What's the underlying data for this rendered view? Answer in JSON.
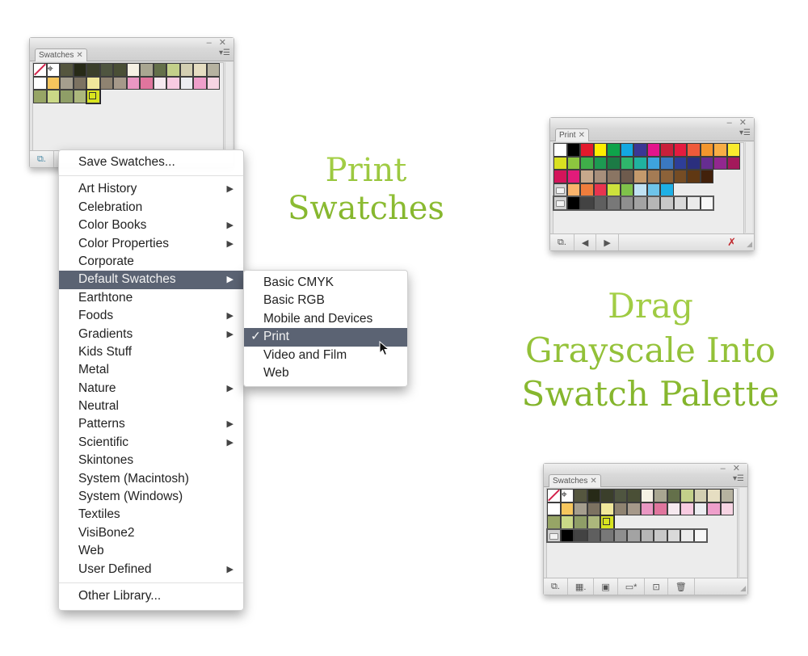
{
  "colors": {
    "menu_highlight": "#5b6373",
    "caption_green": "#8cbf2f"
  },
  "panel_swatches_top": {
    "tab_label": "Swatches",
    "tab_close": "✕",
    "win_controls": "– ✕",
    "panel_menu_icon": "panel-menu-icon",
    "footer_icon": "swatch-libraries-menu-icon",
    "rows": [
      [
        "none",
        "reg",
        "#55563f",
        "#272a17",
        "#3b3f2b",
        "#4f5540",
        "#4a4f36",
        "#f6f1e4",
        "#a9a691",
        "#64704a",
        "#c3d08a",
        "#d3cfb2",
        "#e6dec2",
        "#b6b2a0"
      ],
      [
        "#ffffff",
        "#f6c65d",
        "#a59e8e",
        "#7c7261",
        "#f0e79b",
        "#8f8371",
        "#a6998a",
        "#ea97c3",
        "#e0759d",
        "#f6e9ef",
        "#f8cbe1",
        "#ecedf1",
        "#ef9fcb",
        "#f7d4e3"
      ],
      [
        "#97a566",
        "#cad887",
        "#8f9e67",
        "#acb77c",
        "sel:#d8e41f"
      ]
    ]
  },
  "library_menu": {
    "items": [
      {
        "label": "Save Swatches...",
        "submenu": false
      },
      {
        "separator": true
      },
      {
        "label": "Art History",
        "submenu": true
      },
      {
        "label": "Celebration",
        "submenu": false
      },
      {
        "label": "Color Books",
        "submenu": true
      },
      {
        "label": "Color Properties",
        "submenu": true
      },
      {
        "label": "Corporate",
        "submenu": false
      },
      {
        "label": "Default Swatches",
        "submenu": true,
        "highlighted": true
      },
      {
        "label": "Earthtone",
        "submenu": false
      },
      {
        "label": "Foods",
        "submenu": true
      },
      {
        "label": "Gradients",
        "submenu": true
      },
      {
        "label": "Kids Stuff",
        "submenu": false
      },
      {
        "label": "Metal",
        "submenu": false
      },
      {
        "label": "Nature",
        "submenu": true
      },
      {
        "label": "Neutral",
        "submenu": false
      },
      {
        "label": "Patterns",
        "submenu": true
      },
      {
        "label": "Scientific",
        "submenu": true
      },
      {
        "label": "Skintones",
        "submenu": false
      },
      {
        "label": "System (Macintosh)",
        "submenu": false
      },
      {
        "label": "System (Windows)",
        "submenu": false
      },
      {
        "label": "Textiles",
        "submenu": false
      },
      {
        "label": "VisiBone2",
        "submenu": false
      },
      {
        "label": "Web",
        "submenu": false
      },
      {
        "label": "User Defined",
        "submenu": true
      },
      {
        "separator": true
      },
      {
        "label": "Other Library...",
        "submenu": false
      }
    ],
    "arrow_glyph": "▶"
  },
  "default_swatches_submenu": {
    "items": [
      {
        "label": "Basic CMYK"
      },
      {
        "label": "Basic RGB"
      },
      {
        "label": "Mobile and Devices"
      },
      {
        "label": "Print",
        "checked": true,
        "highlighted": true
      },
      {
        "label": "Video and Film"
      },
      {
        "label": "Web"
      }
    ],
    "check_glyph": "✓"
  },
  "captions": {
    "print_swatches": [
      "Print",
      "Swatches"
    ],
    "drag_grayscale": [
      "Drag",
      "Grayscale Into",
      "Swatch Palette"
    ]
  },
  "panel_print": {
    "tab_label": "Print",
    "tab_close": "✕",
    "win_controls": "– ✕",
    "footer_buttons": [
      {
        "name": "swatch-libraries-menu-icon",
        "glyph": "⧉."
      },
      {
        "name": "previous-library-icon",
        "glyph": "◀"
      },
      {
        "name": "next-library-icon",
        "glyph": "▶"
      }
    ],
    "footer_right_icon": "no-edit-icon",
    "rows": [
      [
        "#ffffff",
        "#000000",
        "#e3192c",
        "#fdee00",
        "#0ea34a",
        "#13a8e1",
        "#3a3795",
        "#e3148c",
        "#c91f3a",
        "#e31b3f",
        "#ef5a3a",
        "#f3962d",
        "#f8ae45",
        "#f9eb2d"
      ],
      [
        "#d9e021",
        "#8dc63f",
        "#3fae49",
        "#1d9a52",
        "#1c7a45",
        "#2fb56b",
        "#20b2a0",
        "#3ea3dc",
        "#3a78c1",
        "#2e3e98",
        "#2b2f7e",
        "#662d91",
        "#92278f",
        "#a3195b"
      ],
      [
        "#d4145a",
        "#e11b7a",
        "#c6a98c",
        "#a78f7b",
        "#8a7563",
        "#6e5b4d",
        "#c49a6c",
        "#a47b54",
        "#8c6239",
        "#754c24",
        "#603813",
        "#42210b"
      ],
      [
        "folder",
        "#f9b36c",
        "#ef7d3c",
        "#e8344f",
        "#cde23c",
        "#7fc24a",
        "#c0e2f3",
        "#6ec4ea",
        "#1eb0e6"
      ],
      [
        "folder",
        "#000000",
        "#434343",
        "#5f5f5f",
        "#787878",
        "#8f8f8f",
        "#a3a3a3",
        "#b6b6b6",
        "#c8c8c8",
        "#dadada",
        "#ebebeb",
        "#f7f7f7"
      ]
    ]
  },
  "panel_swatches_bottom": {
    "tab_label": "Swatches",
    "tab_close": "✕",
    "win_controls": "– ✕",
    "footer_buttons": [
      {
        "name": "swatch-libraries-menu-icon",
        "glyph": "⧉."
      },
      {
        "name": "show-swatch-kinds-icon",
        "glyph": "▦."
      },
      {
        "name": "swatch-options-icon",
        "glyph": "▣"
      },
      {
        "name": "new-color-group-icon",
        "glyph": "▭*"
      },
      {
        "name": "new-swatch-icon",
        "glyph": "⊡"
      },
      {
        "name": "delete-swatch-icon",
        "glyph": "🗑"
      }
    ],
    "rows": [
      [
        "none",
        "reg",
        "#55563f",
        "#272a17",
        "#3b3f2b",
        "#4f5540",
        "#4a4f36",
        "#f6f1e4",
        "#a9a691",
        "#64704a",
        "#c3d08a",
        "#d3cfb2",
        "#e6dec2",
        "#b6b2a0"
      ],
      [
        "#ffffff",
        "#f6c65d",
        "#a59e8e",
        "#7c7261",
        "#f0e79b",
        "#8f8371",
        "#a6998a",
        "#ea97c3",
        "#e0759d",
        "#f6e9ef",
        "#f8cbe1",
        "#ecedf1",
        "#ef9fcb",
        "#f7d4e3"
      ],
      [
        "#97a566",
        "#cad887",
        "#8f9e67",
        "#acb77c",
        "sel:#d8e41f"
      ],
      [
        "folder",
        "#000000",
        "#434343",
        "#5f5f5f",
        "#787878",
        "#8f8f8f",
        "#a3a3a3",
        "#b6b6b6",
        "#c8c8c8",
        "#dadada",
        "#ebebeb",
        "#f7f7f7"
      ]
    ]
  }
}
